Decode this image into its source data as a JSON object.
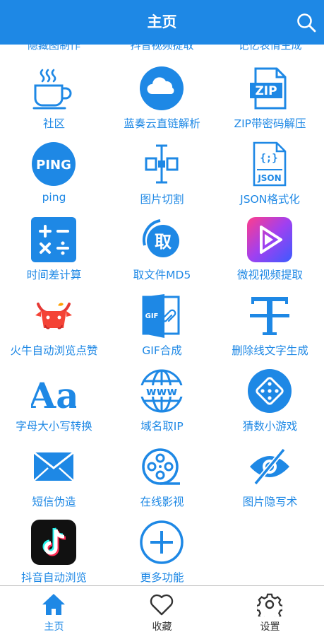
{
  "header": {
    "title": "主页"
  },
  "partial_row": [
    "隐藏图制作",
    "抖音视频提取",
    "记忆表情生成"
  ],
  "grid": [
    {
      "label": "社区",
      "icon": "coffee-cup-icon"
    },
    {
      "label": "蓝奏云直链解析",
      "icon": "cloud-icon"
    },
    {
      "label": "ZIP带密码解压",
      "icon": "zip-file-icon"
    },
    {
      "label": "ping",
      "icon": "ping-icon"
    },
    {
      "label": "图片切割",
      "icon": "split-icon"
    },
    {
      "label": "JSON格式化",
      "icon": "json-file-icon"
    },
    {
      "label": "时间差计算",
      "icon": "calculator-icon"
    },
    {
      "label": "取文件MD5",
      "icon": "md5-icon"
    },
    {
      "label": "微视视频提取",
      "icon": "weishi-play-icon"
    },
    {
      "label": "火牛自动浏览点赞",
      "icon": "fire-bull-icon"
    },
    {
      "label": "GIF合成",
      "icon": "gif-icon"
    },
    {
      "label": "删除线文字生成",
      "icon": "strikethrough-t-icon"
    },
    {
      "label": "字母大小写转换",
      "icon": "letter-case-icon"
    },
    {
      "label": "域名取IP",
      "icon": "www-globe-icon"
    },
    {
      "label": "猜数小游戏",
      "icon": "dice-icon"
    },
    {
      "label": "短信伪造",
      "icon": "envelope-icon"
    },
    {
      "label": "在线影视",
      "icon": "film-reel-icon"
    },
    {
      "label": "图片隐写术",
      "icon": "hidden-eye-icon"
    },
    {
      "label": "抖音自动浏览",
      "icon": "tiktok-icon"
    },
    {
      "label": "更多功能",
      "icon": "plus-circle-icon"
    }
  ],
  "icon_text": {
    "zip": "ZIP",
    "ping": "PING",
    "json_braces": "{;}",
    "json": "JSON",
    "md5": "取",
    "gif": "GIF",
    "letter_case": "Aa",
    "www": "www"
  },
  "nav": [
    {
      "label": "主页",
      "icon": "home-icon"
    },
    {
      "label": "收藏",
      "icon": "heart-icon"
    },
    {
      "label": "设置",
      "icon": "gear-icon"
    }
  ],
  "colors": {
    "primary": "#1e88e5",
    "text": "#333333"
  }
}
